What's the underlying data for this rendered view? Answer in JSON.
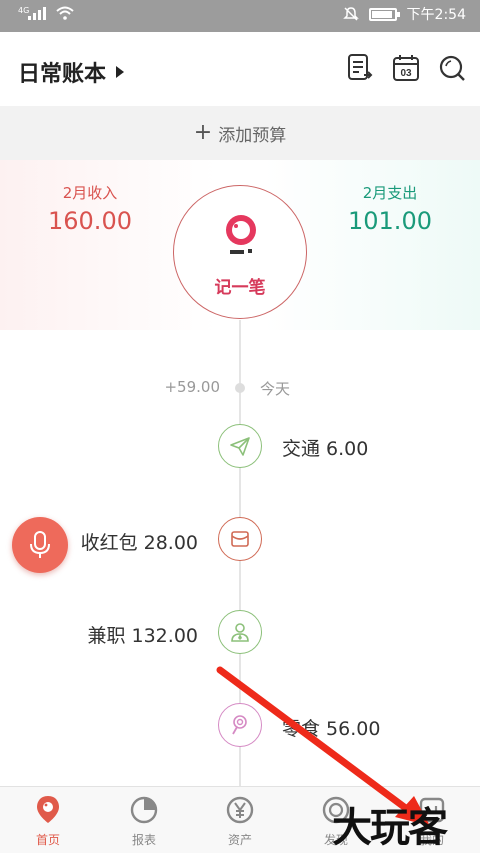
{
  "status_bar": {
    "network": "4G",
    "time": "下午2:54",
    "battery_level": 0.85
  },
  "header": {
    "book_title": "日常账本"
  },
  "budget": {
    "add_label": "添加预算"
  },
  "summary": {
    "income_label": "2月收入",
    "income_value": "160.00",
    "expense_label": "2月支出",
    "expense_value": "101.00",
    "record_label": "记一笔",
    "income_color": "#d9534f",
    "expense_color": "#1a9a7a"
  },
  "timeline": {
    "day_amount": "+59.00",
    "day_label": "今天",
    "entries": [
      {
        "text": "交通 6.00",
        "icon": "paper-plane-icon",
        "color": "#8cc07a",
        "side": "right"
      },
      {
        "text": "收红包 28.00",
        "icon": "envelope-icon",
        "color": "#d06a55",
        "side": "left"
      },
      {
        "text": "兼职 132.00",
        "icon": "worker-icon",
        "color": "#8cc07a",
        "side": "left"
      },
      {
        "text": "零食 56.00",
        "icon": "lollipop-icon",
        "color": "#d58ac4",
        "side": "right"
      }
    ]
  },
  "tabbar": {
    "tabs": [
      {
        "label": "首页",
        "icon": "home-pin-icon",
        "active": true
      },
      {
        "label": "报表",
        "icon": "pie-chart-icon",
        "active": false
      },
      {
        "label": "资产",
        "icon": "yuan-icon",
        "active": false
      },
      {
        "label": "发现",
        "icon": "discover-icon",
        "active": false
      },
      {
        "label": "我的",
        "icon": "profile-icon",
        "active": false
      }
    ]
  },
  "watermark": "大玩客"
}
